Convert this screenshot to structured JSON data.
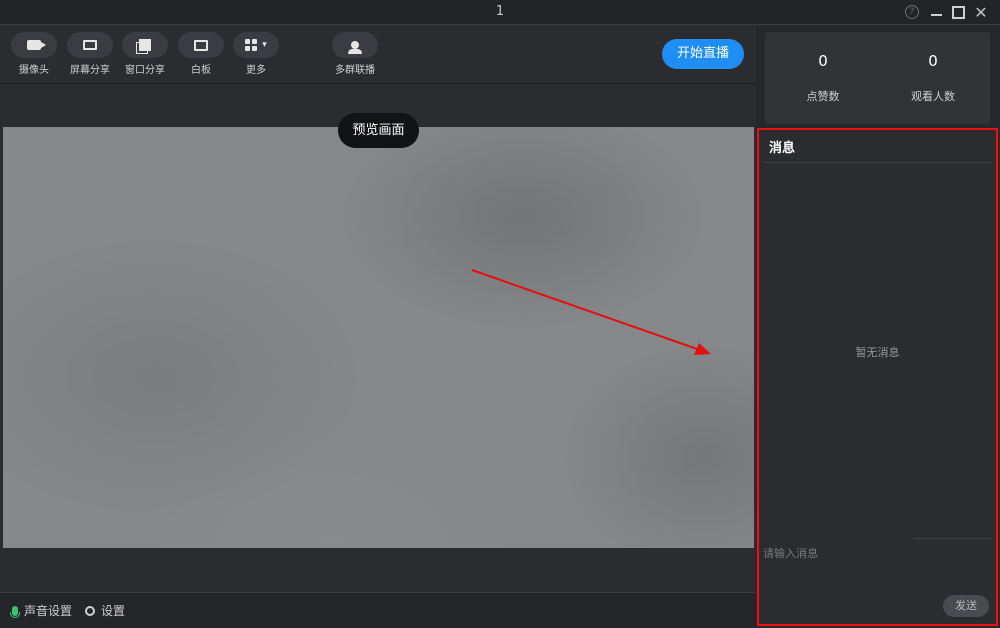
{
  "window": {
    "title": "1"
  },
  "toolbar": {
    "camera": "摄像头",
    "screen_share": "屏幕分享",
    "window_share": "窗口分享",
    "whiteboard": "白板",
    "more": "更多",
    "multi_group": "多群联播"
  },
  "start_button": "开始直播",
  "preview": {
    "label": "预览画面"
  },
  "bottom": {
    "audio_settings": "声音设置",
    "settings": "设置"
  },
  "stats": {
    "likes": {
      "value": "0",
      "label": "点赞数"
    },
    "viewers": {
      "value": "0",
      "label": "观看人数"
    }
  },
  "messages": {
    "title": "消息",
    "empty": "暂无消息",
    "input_placeholder": "请输入消息",
    "send": "发送"
  },
  "colors": {
    "accent": "#1e8ef5",
    "highlight_box": "#e11111",
    "annotation_arrow": "#e11111"
  }
}
